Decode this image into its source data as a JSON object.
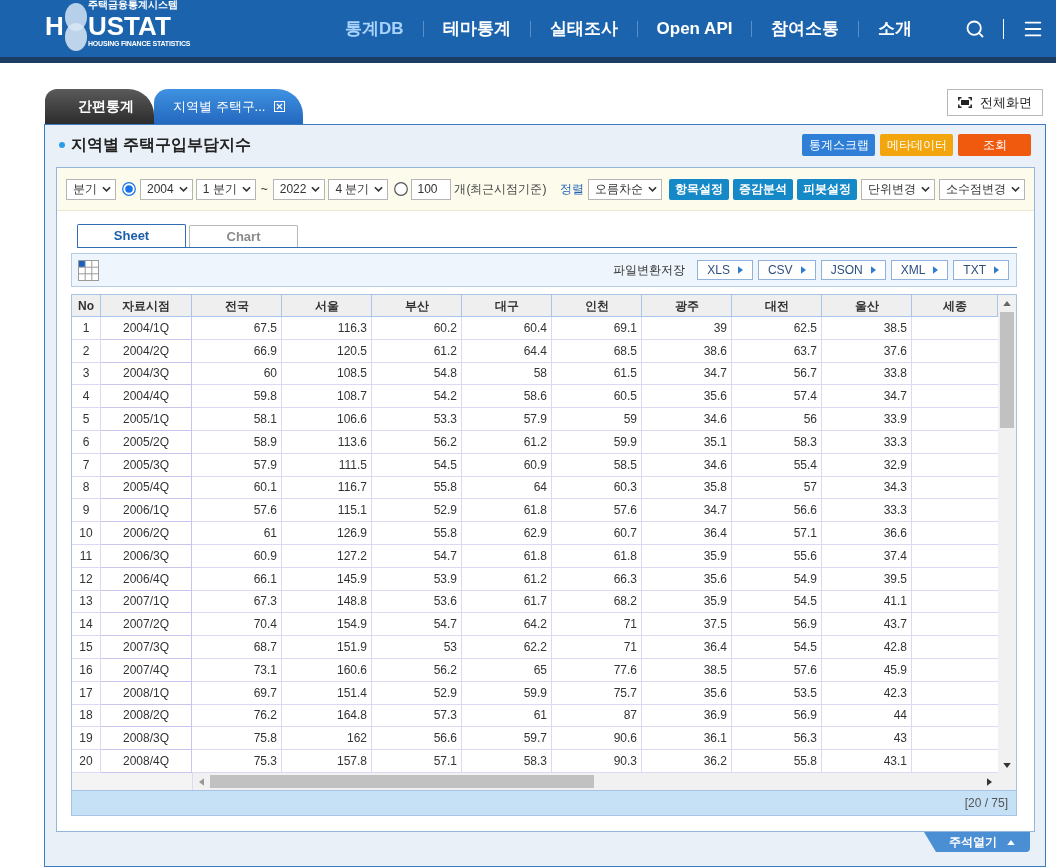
{
  "header": {
    "logo": {
      "tagline": "주택금융통계시스템",
      "name_start": "H",
      "name_end": "USTAT",
      "subtitle": "HOUSING FINANCE STATISTICS"
    },
    "nav": [
      {
        "label": "통계DB",
        "selected": true
      },
      {
        "label": "테마통계",
        "selected": false
      },
      {
        "label": "실태조사",
        "selected": false
      },
      {
        "label": "Open API",
        "selected": false
      },
      {
        "label": "참여소통",
        "selected": false
      },
      {
        "label": "소개",
        "selected": false
      }
    ]
  },
  "tabs": [
    {
      "label": "간편통계",
      "selected": false,
      "closable": false
    },
    {
      "label": "지역별 주택구...",
      "selected": true,
      "closable": true
    }
  ],
  "fullscreen_button": "전체화면",
  "panel": {
    "title": "지역별 주택구입부담지수",
    "buttons": [
      {
        "label": "통계스크랩",
        "color": "#2f7fd6"
      },
      {
        "label": "메타데이터",
        "color": "#f2a50c"
      },
      {
        "label": "조회",
        "color": "#f05a0e"
      }
    ]
  },
  "filters": {
    "period_unit": "분기",
    "range": {
      "selected": true,
      "start_year": "2004",
      "start_quarter": "1 분기",
      "separator": "~",
      "end_year": "2022",
      "end_quarter": "4 분기"
    },
    "recent": {
      "selected": false,
      "count": "100",
      "label": "개(최근시점기준)"
    },
    "sort": {
      "label": "정렬",
      "value": "오름차순"
    },
    "actions": [
      "항목설정",
      "증감분석",
      "피봇설정"
    ],
    "selects": [
      "단위변경",
      "소수점변경"
    ]
  },
  "view_tabs": [
    {
      "label": "Sheet",
      "selected": true
    },
    {
      "label": "Chart",
      "selected": false
    }
  ],
  "export": {
    "label": "파일변환저장",
    "formats": [
      "XLS",
      "CSV",
      "JSON",
      "XML",
      "TXT"
    ]
  },
  "table": {
    "columns": [
      "No",
      "자료시점",
      "전국",
      "서울",
      "부산",
      "대구",
      "인천",
      "광주",
      "대전",
      "울산",
      "세종"
    ],
    "rows": [
      {
        "no": "1",
        "period": "2004/1Q",
        "values": [
          "67.5",
          "116.3",
          "60.2",
          "60.4",
          "69.1",
          "39",
          "62.5",
          "38.5"
        ]
      },
      {
        "no": "2",
        "period": "2004/2Q",
        "values": [
          "66.9",
          "120.5",
          "61.2",
          "64.4",
          "68.5",
          "38.6",
          "63.7",
          "37.6"
        ]
      },
      {
        "no": "3",
        "period": "2004/3Q",
        "values": [
          "60",
          "108.5",
          "54.8",
          "58",
          "61.5",
          "34.7",
          "56.7",
          "33.8"
        ]
      },
      {
        "no": "4",
        "period": "2004/4Q",
        "values": [
          "59.8",
          "108.7",
          "54.2",
          "58.6",
          "60.5",
          "35.6",
          "57.4",
          "34.7"
        ]
      },
      {
        "no": "5",
        "period": "2005/1Q",
        "values": [
          "58.1",
          "106.6",
          "53.3",
          "57.9",
          "59",
          "34.6",
          "56",
          "33.9"
        ]
      },
      {
        "no": "6",
        "period": "2005/2Q",
        "values": [
          "58.9",
          "113.6",
          "56.2",
          "61.2",
          "59.9",
          "35.1",
          "58.3",
          "33.3"
        ]
      },
      {
        "no": "7",
        "period": "2005/3Q",
        "values": [
          "57.9",
          "111.5",
          "54.5",
          "60.9",
          "58.5",
          "34.6",
          "55.4",
          "32.9"
        ]
      },
      {
        "no": "8",
        "period": "2005/4Q",
        "values": [
          "60.1",
          "116.7",
          "55.8",
          "64",
          "60.3",
          "35.8",
          "57",
          "34.3"
        ]
      },
      {
        "no": "9",
        "period": "2006/1Q",
        "values": [
          "57.6",
          "115.1",
          "52.9",
          "61.8",
          "57.6",
          "34.7",
          "56.6",
          "33.3"
        ]
      },
      {
        "no": "10",
        "period": "2006/2Q",
        "values": [
          "61",
          "126.9",
          "55.8",
          "62.9",
          "60.7",
          "36.4",
          "57.1",
          "36.6"
        ]
      },
      {
        "no": "11",
        "period": "2006/3Q",
        "values": [
          "60.9",
          "127.2",
          "54.7",
          "61.8",
          "61.8",
          "35.9",
          "55.6",
          "37.4"
        ]
      },
      {
        "no": "12",
        "period": "2006/4Q",
        "values": [
          "66.1",
          "145.9",
          "53.9",
          "61.2",
          "66.3",
          "35.6",
          "54.9",
          "39.5"
        ]
      },
      {
        "no": "13",
        "period": "2007/1Q",
        "values": [
          "67.3",
          "148.8",
          "53.6",
          "61.7",
          "68.2",
          "35.9",
          "54.5",
          "41.1"
        ]
      },
      {
        "no": "14",
        "period": "2007/2Q",
        "values": [
          "70.4",
          "154.9",
          "54.7",
          "64.2",
          "71",
          "37.5",
          "56.9",
          "43.7"
        ]
      },
      {
        "no": "15",
        "period": "2007/3Q",
        "values": [
          "68.7",
          "151.9",
          "53",
          "62.2",
          "71",
          "36.4",
          "54.5",
          "42.8"
        ]
      },
      {
        "no": "16",
        "period": "2007/4Q",
        "values": [
          "73.1",
          "160.6",
          "56.2",
          "65",
          "77.6",
          "38.5",
          "57.6",
          "45.9"
        ]
      },
      {
        "no": "17",
        "period": "2008/1Q",
        "values": [
          "69.7",
          "151.4",
          "52.9",
          "59.9",
          "75.7",
          "35.6",
          "53.5",
          "42.3"
        ]
      },
      {
        "no": "18",
        "period": "2008/2Q",
        "values": [
          "76.2",
          "164.8",
          "57.3",
          "61",
          "87",
          "36.9",
          "56.9",
          "44"
        ]
      },
      {
        "no": "19",
        "period": "2008/3Q",
        "values": [
          "75.8",
          "162",
          "56.6",
          "59.7",
          "90.6",
          "36.1",
          "56.3",
          "43"
        ]
      },
      {
        "no": "20",
        "period": "2008/4Q",
        "values": [
          "75.3",
          "157.8",
          "57.1",
          "58.3",
          "90.3",
          "36.2",
          "55.8",
          "43.1"
        ]
      }
    ]
  },
  "pager": "[20 / 75]",
  "notes_toggle": "주석열기"
}
